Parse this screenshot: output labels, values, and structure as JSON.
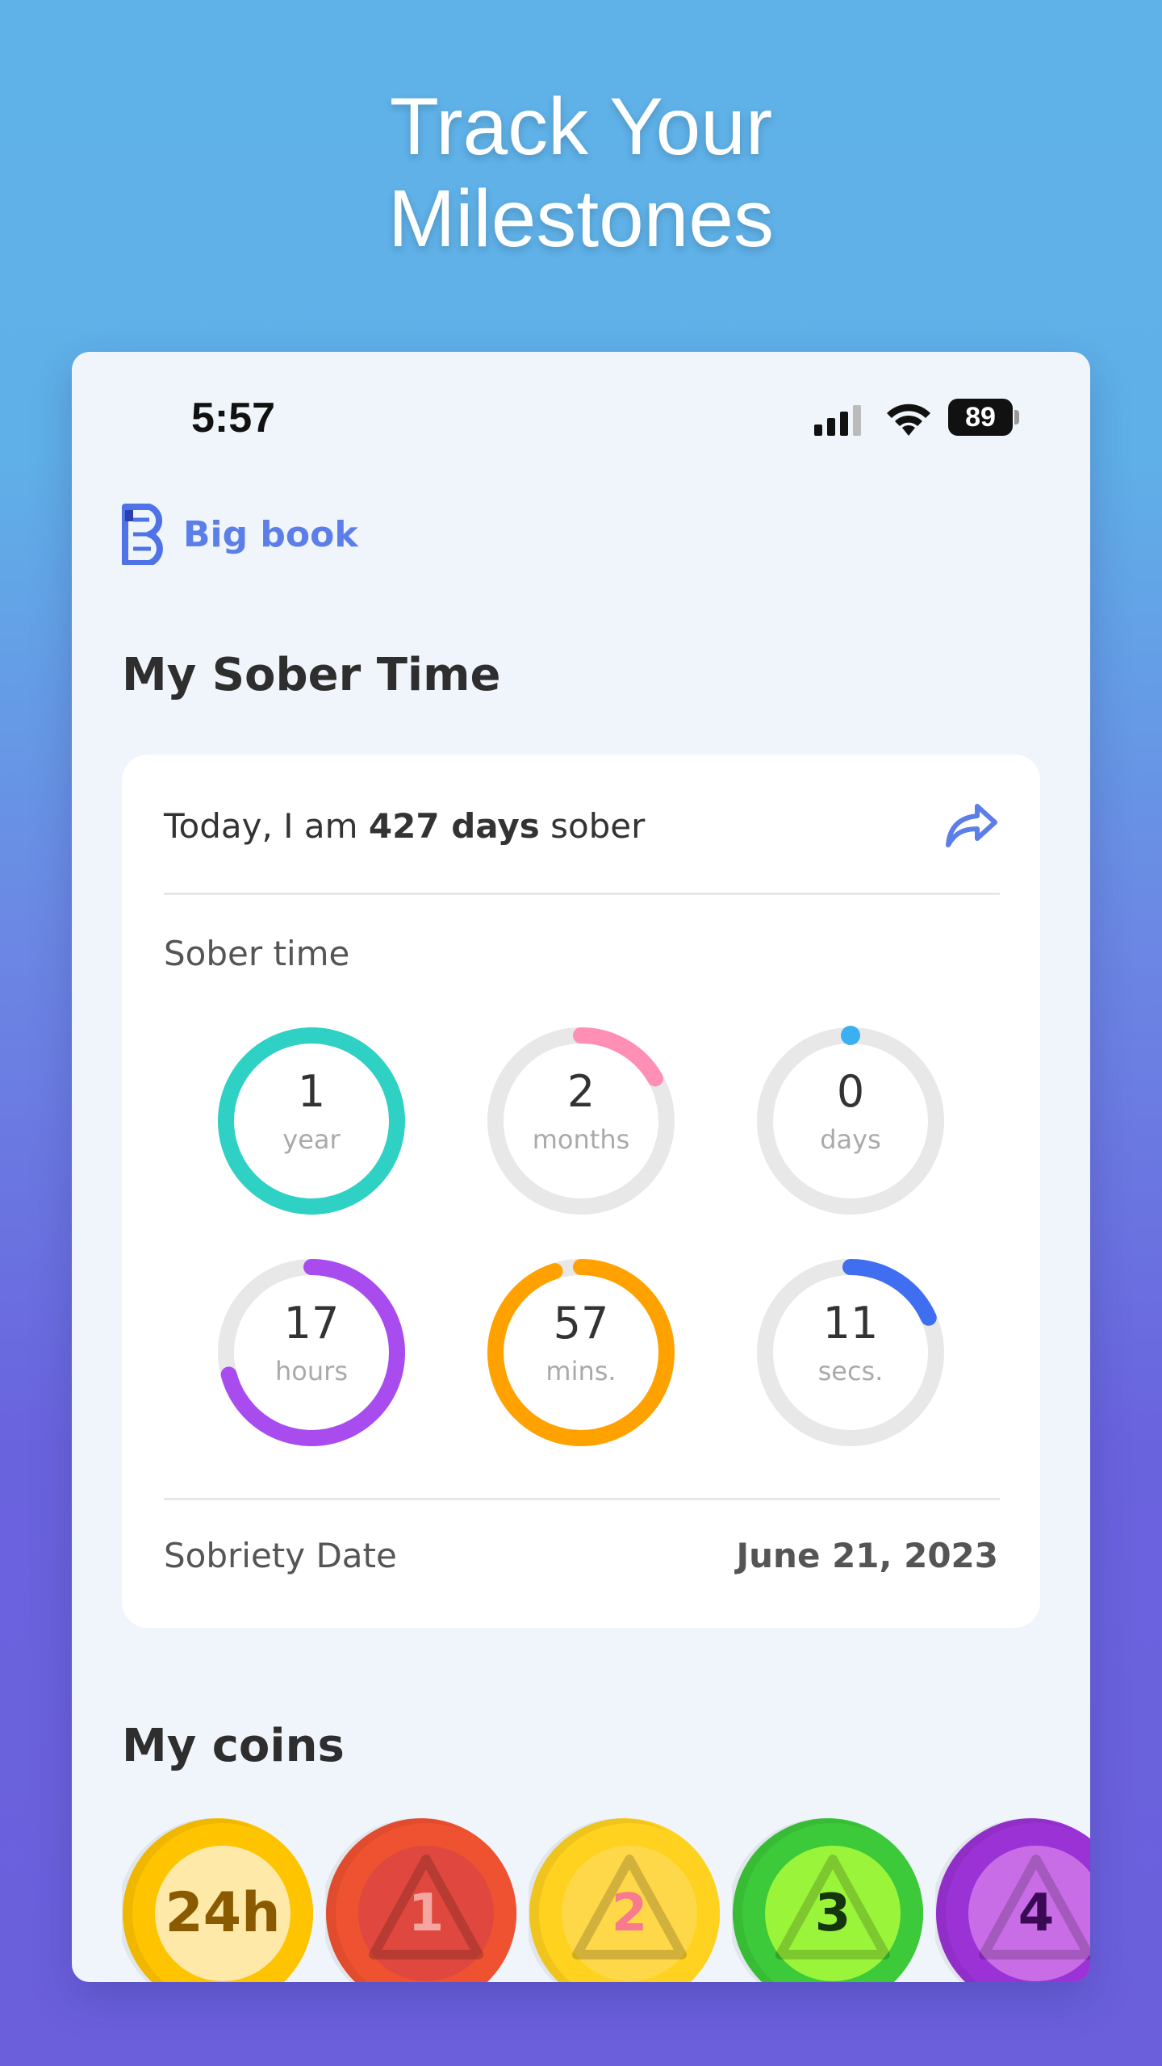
{
  "headline": {
    "line1": "Track Your",
    "line2": "Milestones"
  },
  "status_bar": {
    "time": "5:57",
    "battery": "89"
  },
  "brand": {
    "name": "Big book"
  },
  "sober_section": {
    "title": "My Sober Time",
    "today_prefix": "Today, I am ",
    "today_bold": "427 days",
    "today_suffix": " sober",
    "sober_time_label": "Sober time",
    "dials": [
      {
        "value": "1",
        "unit": "year",
        "fraction": 1.0,
        "color": "#2fd1c4"
      },
      {
        "value": "2",
        "unit": "months",
        "fraction": 0.167,
        "color": "#ff8fb5"
      },
      {
        "value": "0",
        "unit": "days",
        "fraction": 0.0,
        "color": "#3bb0f0"
      },
      {
        "value": "17",
        "unit": "hours",
        "fraction": 0.708,
        "color": "#a84cf0"
      },
      {
        "value": "57",
        "unit": "mins.",
        "fraction": 0.95,
        "color": "#ffa200"
      },
      {
        "value": "11",
        "unit": "secs.",
        "fraction": 0.183,
        "color": "#3f6ff0"
      }
    ],
    "sobriety_date_label": "Sobriety Date",
    "sobriety_date_value": "June 21, 2023"
  },
  "coins_section": {
    "title": "My coins",
    "coins": [
      {
        "label": "24h",
        "outer": "#ffc400",
        "inner": "#ffe9a8",
        "text": "#8a5a00"
      },
      {
        "label": "1",
        "outer": "#ef5230",
        "inner": "#e0473f",
        "text": "#f4a7a0"
      },
      {
        "label": "2",
        "outer": "#ffd21f",
        "inner": "#ffd84a",
        "text": "#f77a8e"
      },
      {
        "label": "3",
        "outer": "#3cc93a",
        "inner": "#9af53a",
        "text": "#15350f"
      },
      {
        "label": "4",
        "outer": "#9b32d6",
        "inner": "#c96de6",
        "text": "#3a0a55"
      }
    ]
  }
}
